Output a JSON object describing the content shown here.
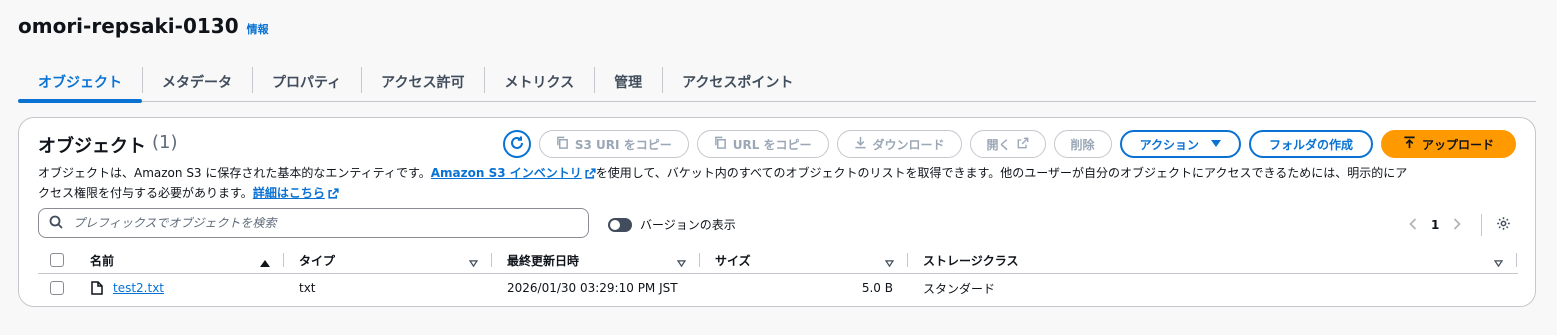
{
  "header": {
    "bucket_name": "omori-repsaki-0130",
    "info_label": "情報"
  },
  "tabs": [
    {
      "label": "オブジェクト",
      "active": true
    },
    {
      "label": "メタデータ",
      "active": false
    },
    {
      "label": "プロパティ",
      "active": false
    },
    {
      "label": "アクセス許可",
      "active": false
    },
    {
      "label": "メトリクス",
      "active": false
    },
    {
      "label": "管理",
      "active": false
    },
    {
      "label": "アクセスポイント",
      "active": false
    }
  ],
  "objects_panel": {
    "title": "オブジェクト",
    "count": "(1)",
    "toolbar": {
      "copy_s3_uri": "S3 URI をコピー",
      "copy_url": "URL をコピー",
      "download": "ダウンロード",
      "open": "開く",
      "delete": "削除",
      "actions": "アクション",
      "create_folder": "フォルダの作成",
      "upload": "アップロード"
    },
    "description": {
      "part1": "オブジェクトは、Amazon S3 に保存された基本的なエンティティです。",
      "inventory_link": "Amazon S3 インベントリ",
      "part2": "を使用して、バケット内のすべてのオブジェクトのリストを取得できます。他のユーザーが自分のオブジェクトにアクセスできるためには、明示的にア",
      "part3": "クセス権限を付与する必要があります。",
      "learn_more_link": "詳細はこちら"
    },
    "search": {
      "placeholder": "プレフィックスでオブジェクトを検索",
      "value": ""
    },
    "versions_toggle": {
      "label": "バージョンの表示",
      "on": false
    },
    "pagination": {
      "current_page": "1"
    },
    "table": {
      "columns": [
        "名前",
        "タイプ",
        "最終更新日時",
        "サイズ",
        "ストレージクラス"
      ],
      "rows": [
        {
          "name": "test2.txt",
          "type": "txt",
          "last_modified": "2026/01/30 03:29:10 PM JST",
          "size": "5.0 B",
          "storage_class": "スタンダード"
        }
      ]
    }
  },
  "colors": {
    "link_blue": "#0972d3",
    "upload_orange": "#ff9900",
    "disabled_gray": "#9ba7b6"
  },
  "icons": [
    "refresh-icon",
    "copy-icon",
    "download-icon",
    "external-link-icon",
    "caret-down-icon",
    "upload-icon",
    "search-icon",
    "settings-gear-icon",
    "file-icon",
    "sort-ascending-icon",
    "sort-icon",
    "chevron-left-icon",
    "chevron-right-icon"
  ]
}
